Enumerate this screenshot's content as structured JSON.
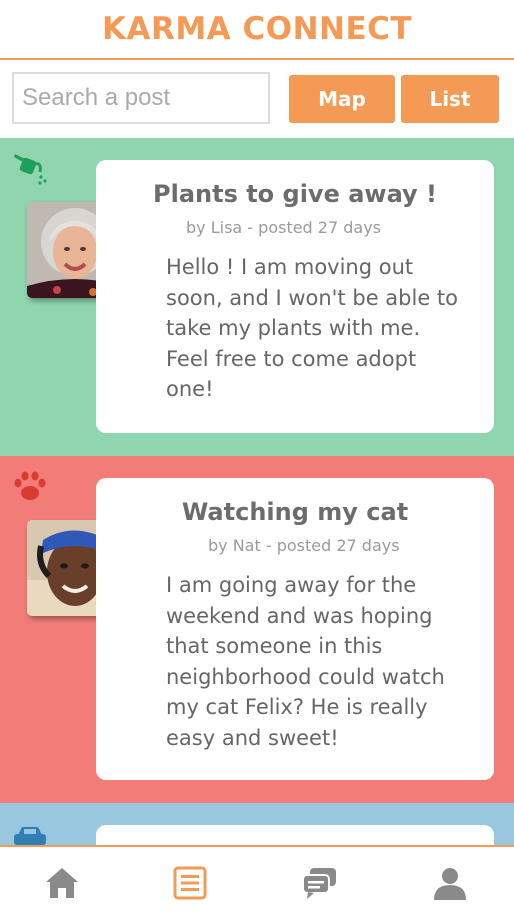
{
  "app": {
    "title": "KARMA CONNECT"
  },
  "search": {
    "placeholder": "Search a post"
  },
  "view_toggle": {
    "map_label": "Map",
    "list_label": "List"
  },
  "posts": [
    {
      "category_icon": "watering-can-icon",
      "color": "#8fd5b0",
      "title": "Plants to give away !",
      "meta": "by Lisa - posted 27 days",
      "body": "Hello ! I am moving out soon, and I won't be able to take my plants with me. Feel free to come adopt one!",
      "avatar": "lisa-avatar"
    },
    {
      "category_icon": "paw-icon",
      "color": "#f27d78",
      "title": "Watching my cat",
      "meta": "by Nat - posted 27 days",
      "body": "I am going away for the weekend and was hoping that someone in this neighborhood could watch my cat Felix? He is really easy and sweet!",
      "avatar": "nat-avatar"
    },
    {
      "category_icon": "car-icon",
      "color": "#98c7df"
    }
  ],
  "bottom_nav": [
    {
      "icon": "home-icon",
      "active": false
    },
    {
      "icon": "list-icon",
      "active": true
    },
    {
      "icon": "chat-icon",
      "active": false
    },
    {
      "icon": "profile-icon",
      "active": false
    }
  ],
  "colors": {
    "accent": "#f59a55",
    "inactive_icon": "#8a8a8a"
  }
}
